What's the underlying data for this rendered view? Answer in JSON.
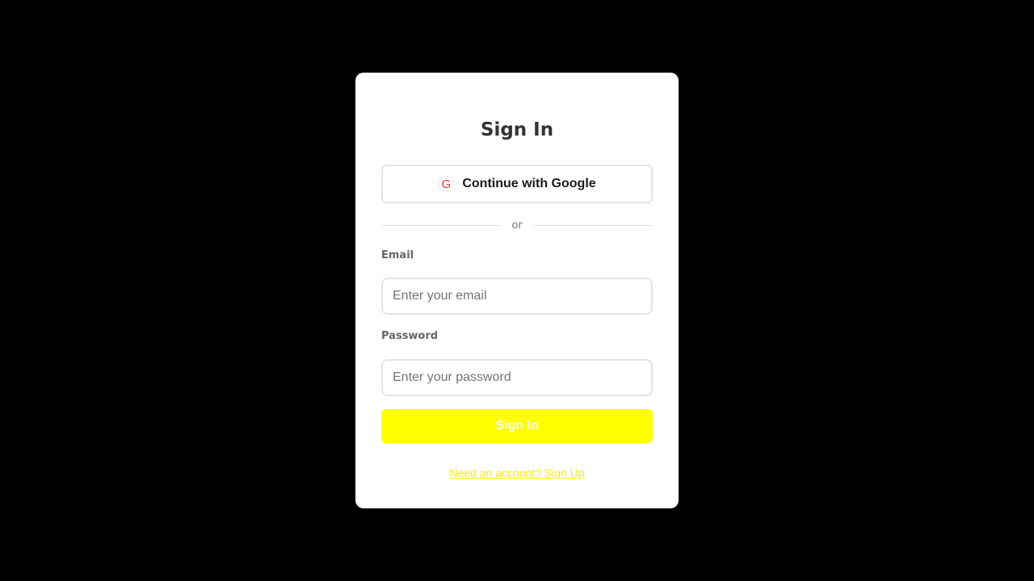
{
  "auth": {
    "title": "Sign In",
    "google": {
      "icon_letter": "G",
      "icon": "google-icon",
      "label": "Continue with Google"
    },
    "divider_text": "or",
    "email": {
      "label": "Email",
      "value": "",
      "placeholder": "Enter your email"
    },
    "password": {
      "label": "Password",
      "value": "",
      "placeholder": "Enter your password"
    },
    "submit_label": "Sign In",
    "signup_link": "Need an account? Sign Up"
  },
  "colors": {
    "background": "#000000",
    "card": "#ffffff",
    "accent": "#ffff00",
    "google_red": "#e53935"
  }
}
